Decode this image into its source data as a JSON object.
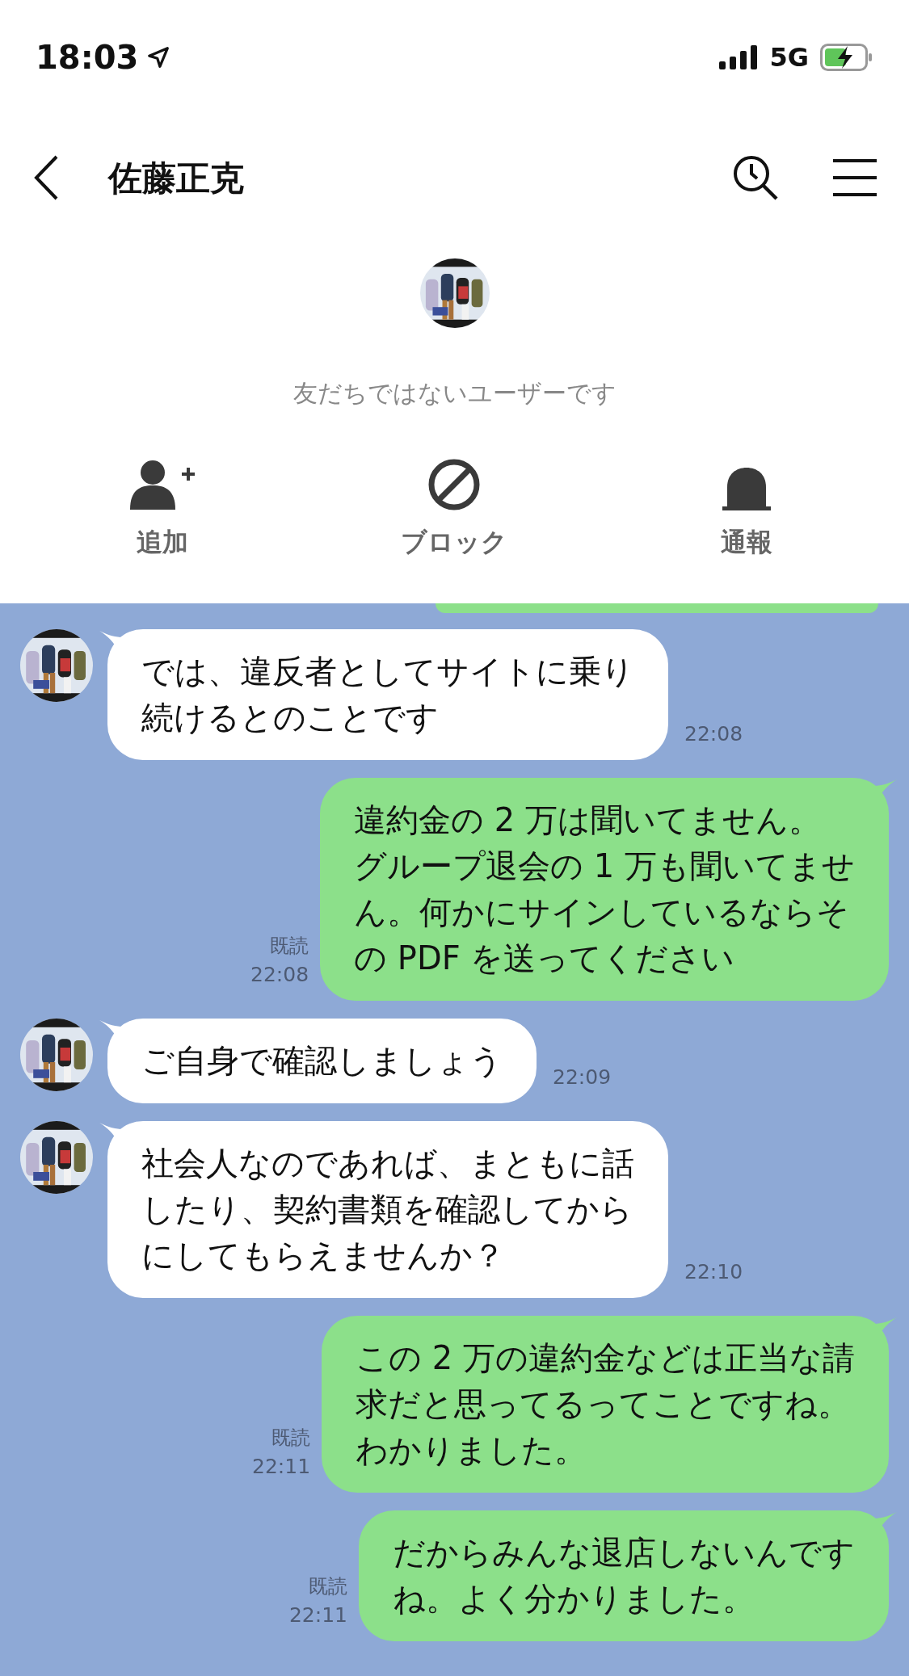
{
  "status_bar": {
    "time": "18:03",
    "network": "5G"
  },
  "header": {
    "title": "佐藤正克"
  },
  "profile": {
    "notice": "友だちではないユーザーです"
  },
  "actions": [
    {
      "kind": "add",
      "label": "追加"
    },
    {
      "kind": "block",
      "label": "ブロック"
    },
    {
      "kind": "report",
      "label": "通報"
    }
  ],
  "messages": [
    {
      "kind": "incoming",
      "lines": [
        "では、違反者としてサイトに乗り",
        "続けるとのことです"
      ],
      "time": "22:08"
    },
    {
      "kind": "outgoing",
      "lines": [
        "違約金の 2 万は聞いてません。",
        "グループ退会の 1 万も聞いてませ",
        "ん。何かにサインしているならそ",
        "の PDF を送ってください"
      ],
      "read": "既読",
      "time": "22:08"
    },
    {
      "kind": "incoming",
      "lines": [
        "ご自身で確認しましょう"
      ],
      "time": "22:09"
    },
    {
      "kind": "incoming",
      "lines": [
        "社会人なのであれば、まともに話",
        "したり、契約書類を確認してから",
        "にしてもらえませんか？"
      ],
      "time": "22:10"
    },
    {
      "kind": "outgoing",
      "lines": [
        "この 2 万の違約金などは正当な請",
        "求だと思ってるってことですね。",
        "わかりました。"
      ],
      "read": "既読",
      "time": "22:11"
    },
    {
      "kind": "outgoing",
      "lines": [
        "だからみんな退店しないんです",
        "ね。よく分かりました。"
      ],
      "read": "既読",
      "time": "22:11"
    }
  ]
}
